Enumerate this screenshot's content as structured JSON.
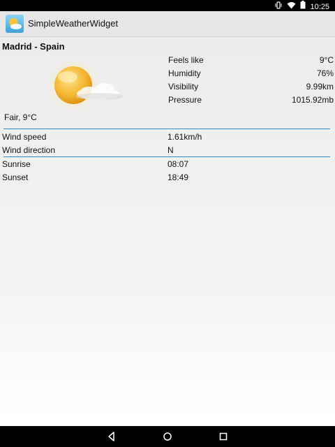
{
  "status_bar": {
    "time": "10:25",
    "icons": [
      "vibrate-icon",
      "wifi-icon",
      "battery-icon"
    ]
  },
  "app": {
    "title": "SimpleWeatherWidget",
    "icon": "weather-app-icon"
  },
  "location": "Madrid - Spain",
  "condition": "Fair, 9°C",
  "weather_icon": "sun-with-cloud-icon",
  "stats": [
    {
      "label": "Feels like",
      "value": "9°C"
    },
    {
      "label": "Humidity",
      "value": "76%"
    },
    {
      "label": "Visibility",
      "value": "9.99km"
    },
    {
      "label": "Pressure",
      "value": "1015.92mb"
    }
  ],
  "wind": {
    "speed_label": "Wind speed",
    "speed_value": "1.61km/h",
    "direction_label": "Wind direction",
    "direction_value": "N"
  },
  "sun": {
    "sunrise_label": "Sunrise",
    "sunrise_value": "08:07",
    "sunset_label": "Sunset",
    "sunset_value": "18:49"
  },
  "colors": {
    "divider": "#2d8fc7",
    "action_bar": "#e6e6e6",
    "sun": "#f2b22c"
  },
  "nav_bar": {
    "buttons": [
      "back-icon",
      "home-icon",
      "recents-icon"
    ]
  }
}
